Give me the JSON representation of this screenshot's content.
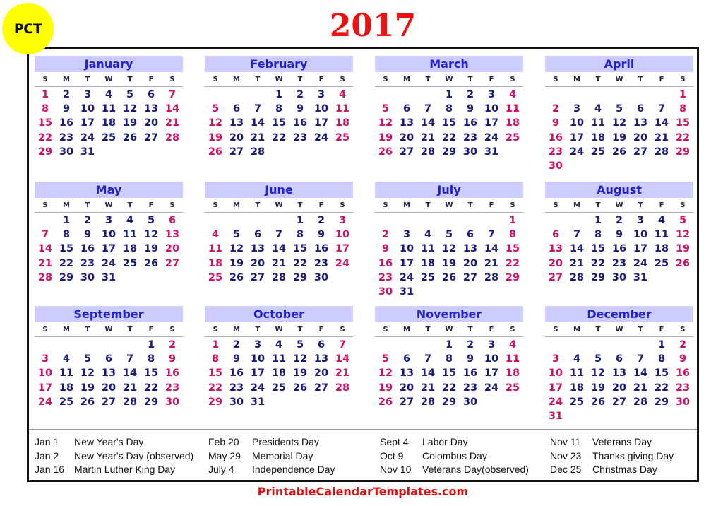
{
  "badge": "PCT",
  "year": "2017",
  "weekday_headers": [
    "S",
    "M",
    "T",
    "W",
    "T",
    "F",
    "S"
  ],
  "months": [
    {
      "name": "January",
      "start": 0,
      "days": 31
    },
    {
      "name": "February",
      "start": 3,
      "days": 28
    },
    {
      "name": "March",
      "start": 3,
      "days": 31
    },
    {
      "name": "April",
      "start": 6,
      "days": 30
    },
    {
      "name": "May",
      "start": 1,
      "days": 31
    },
    {
      "name": "June",
      "start": 4,
      "days": 30
    },
    {
      "name": "July",
      "start": 6,
      "days": 31
    },
    {
      "name": "August",
      "start": 2,
      "days": 31
    },
    {
      "name": "September",
      "start": 5,
      "days": 30
    },
    {
      "name": "October",
      "start": 0,
      "days": 31
    },
    {
      "name": "November",
      "start": 3,
      "days": 30
    },
    {
      "name": "December",
      "start": 5,
      "days": 31
    }
  ],
  "holidays": [
    [
      {
        "date": "Jan 1",
        "name": "New Year's Day"
      },
      {
        "date": "Jan 2",
        "name": "New Year's Day (observed)"
      },
      {
        "date": "Jan 16",
        "name": "Martin Luther King Day"
      }
    ],
    [
      {
        "date": "Feb 20",
        "name": "Presidents Day"
      },
      {
        "date": "May 29",
        "name": "Memorial Day"
      },
      {
        "date": "July 4",
        "name": "Independence Day"
      }
    ],
    [
      {
        "date": "Sept 4",
        "name": "Labor Day"
      },
      {
        "date": "Oct 9",
        "name": "Colombus Day"
      },
      {
        "date": "Nov 10",
        "name": "Veterans Day(observed)"
      }
    ],
    [
      {
        "date": "Nov 11",
        "name": "Veterans Day"
      },
      {
        "date": "Nov 23",
        "name": "Thanks giving Day"
      },
      {
        "date": "Dec 25",
        "name": "Christmas Day"
      }
    ]
  ],
  "colors": {
    "weekend": "#cc1166",
    "weekday": "#1a1a78",
    "month_header_bg": "#ccccff",
    "month_header_text": "#2222cc",
    "year": "#ee1111",
    "badge": "#ffff00"
  },
  "footer": "PrintableCalendarTemplates.com"
}
